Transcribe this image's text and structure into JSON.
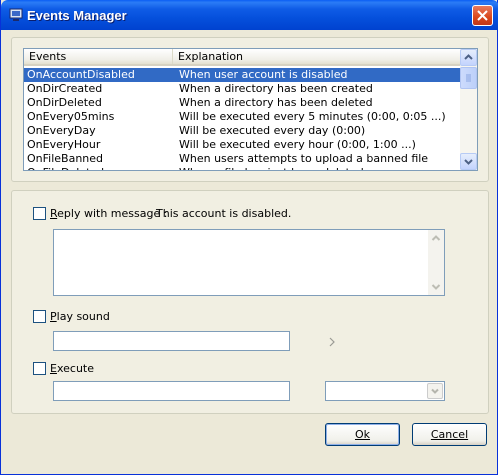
{
  "window": {
    "title": "Events Manager",
    "icon": "app-icon",
    "close_icon": "close-icon"
  },
  "events_list": {
    "columns": [
      "Events",
      "Explanation"
    ],
    "rows": [
      {
        "event": "OnAccountDisabled",
        "explanation": "When user account is disabled",
        "selected": true
      },
      {
        "event": "OnDirCreated",
        "explanation": "When a directory has been created",
        "selected": false
      },
      {
        "event": "OnDirDeleted",
        "explanation": "When a directory has been deleted",
        "selected": false
      },
      {
        "event": "OnEvery05mins",
        "explanation": "Will be executed every 5 minutes (0:00, 0:05 ...)",
        "selected": false
      },
      {
        "event": "OnEveryDay",
        "explanation": "Will be executed every day (0:00)",
        "selected": false
      },
      {
        "event": "OnEveryHour",
        "explanation": "Will be executed every hour (0:00, 1:00 ...)",
        "selected": false
      },
      {
        "event": "OnFileBanned",
        "explanation": "When users attempts to upload a banned file",
        "selected": false
      },
      {
        "event": "OnFileDeleted",
        "explanation": "When a file has just been deleted",
        "selected": false
      }
    ]
  },
  "options": {
    "reply": {
      "label": "Reply with message :",
      "hint": "This account is disabled.",
      "checked": false,
      "message": ""
    },
    "play_sound": {
      "label": "Play sound",
      "checked": false,
      "value": ""
    },
    "execute": {
      "label": "Execute",
      "checked": false,
      "value": "",
      "combo_value": ""
    }
  },
  "buttons": {
    "ok": "Ok",
    "cancel": "Cancel"
  },
  "colors": {
    "selection": "#316ac5",
    "titlebar": "#0550dc",
    "window_bg": "#ece9d8"
  }
}
